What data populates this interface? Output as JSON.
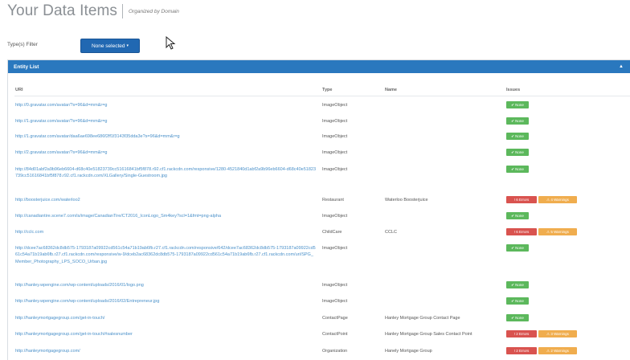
{
  "header": {
    "title": "Your Data Items",
    "subtitle": "Organized by Domain"
  },
  "filter": {
    "label": "Type(s) Filter",
    "button_label": "None selected",
    "caret": "▾"
  },
  "panel": {
    "title": "Entity List",
    "collapse_glyph": "▲"
  },
  "columns": {
    "uri": "URI",
    "type": "Type",
    "name": "Name",
    "issues": "Issues"
  },
  "colors": {
    "accent": "#2a78be",
    "button": "#2168b2",
    "ok": "#5cb85c",
    "error": "#d9534f",
    "warning": "#f0ad4e",
    "link": "#4a90c9"
  },
  "rows": [
    {
      "uri": "http://0.gravatar.com/avatar/?s=96&d=mm&r=g",
      "type": "ImageObject",
      "name": "",
      "issues": [
        {
          "kind": "ok",
          "label": "✔ None"
        }
      ]
    },
    {
      "uri": "http://1.gravatar.com/avatar/?s=96&d=mm&r=g",
      "type": "ImageObject",
      "name": "",
      "issues": [
        {
          "kind": "ok",
          "label": "✔ None"
        }
      ]
    },
    {
      "uri": "http://1.gravatar.com/avatar/daa6ae698ee686f2ff1f3143f35dda3e?s=96&d=mm&r=g",
      "type": "ImageObject",
      "name": "",
      "issues": [
        {
          "kind": "ok",
          "label": "✔ None"
        }
      ]
    },
    {
      "uri": "http://2.gravatar.com/avatar/?s=96&d=mm&r=g",
      "type": "ImageObject",
      "name": "",
      "issues": [
        {
          "kind": "ok",
          "label": "✔ None"
        }
      ]
    },
    {
      "uri": "http://84d01abf2a9b96eb6604-d68c40e51823739cc51616841bf5f878.r92.cf1.rackcdn.com/responsive/1280-4521840d1abf2a9b96eb6604-d68c40e51823739cc51616841bf5f878.r92.cf1.rackcdn.com/XLGallery/Single-Guestroom.jpg",
      "type": "ImageObject",
      "name": "",
      "issues": [
        {
          "kind": "ok",
          "label": "✔ None"
        }
      ]
    },
    {
      "uri": "http://boosterjuice.com/waterloo2",
      "type": "Restaurant",
      "name": "Waterloo Boosterjuice",
      "issues": [
        {
          "kind": "err",
          "label": "! 6 Errors"
        },
        {
          "kind": "warn",
          "label": "⚠ 4 Warnings"
        }
      ]
    },
    {
      "uri": "http://canadiantire.scene7.com/is/image/CanadianTire/CT2016_IconLogo_Sm4key?scl=1&fmt=png-alpha",
      "type": "ImageObject",
      "name": "",
      "issues": [
        {
          "kind": "ok",
          "label": "✔ None"
        }
      ]
    },
    {
      "uri": "http://cclc.com",
      "type": "ChildCare",
      "name": "CCLC",
      "issues": [
        {
          "kind": "err",
          "label": "! 6 Errors"
        },
        {
          "kind": "warn",
          "label": "⚠ 5 Warnings"
        }
      ]
    },
    {
      "uri": "http://dcee7ac68362dc8db575-1793187a09922cd561c54a71b19ab6fb.r27.cf1.rackcdn.com/responsive/642/dcee7ac68362dc8db575-1793187a09922cd561c54a71b19ab6fb.r27.cf1.rackcdn.com/responsive/w-9/dceb2ac68362dc8db575-1793187a09922cd561c54a71b19ab6fb.r27.cf1.rackcdn.com/uri/SPG_Member_Photography_LPS_SOCO_Urban.jpg",
      "type": "ImageObject",
      "name": "",
      "issues": [
        {
          "kind": "ok",
          "label": "✔ None"
        }
      ]
    },
    {
      "uri": "http://hanley.wpengine.com/wp-content/uploads/2016/01/logo.png",
      "type": "ImageObject",
      "name": "",
      "issues": [
        {
          "kind": "ok",
          "label": "✔ None"
        }
      ]
    },
    {
      "uri": "http://hanley.wpengine.com/wp-content/uploads/2016/02/Entrepreneur.jpg",
      "type": "ImageObject",
      "name": "",
      "issues": [
        {
          "kind": "ok",
          "label": "✔ None"
        }
      ]
    },
    {
      "uri": "http://hanleymortgagegroup.com/get-in-touch/",
      "type": "ContactPage",
      "name": "Hanley Mortgage Group Contact Page",
      "issues": [
        {
          "kind": "ok",
          "label": "✔ None"
        }
      ]
    },
    {
      "uri": "http://hanleymortgagegroup.com/get-in-touch/#salesnumber",
      "type": "ContactPoint",
      "name": "Hanley Mortgage Group Sales Contact Point",
      "issues": [
        {
          "kind": "err",
          "label": "! 2 Errors"
        },
        {
          "kind": "warn",
          "label": "⚠ 3 Warnings"
        }
      ]
    },
    {
      "uri": "http://hanleymortgagegroup.com/",
      "type": "Organization",
      "name": "Hanely Mortgage Group",
      "issues": [
        {
          "kind": "err",
          "label": "! 2 Errors"
        },
        {
          "kind": "warn",
          "label": "⚠ 2 Warnings"
        }
      ]
    }
  ]
}
